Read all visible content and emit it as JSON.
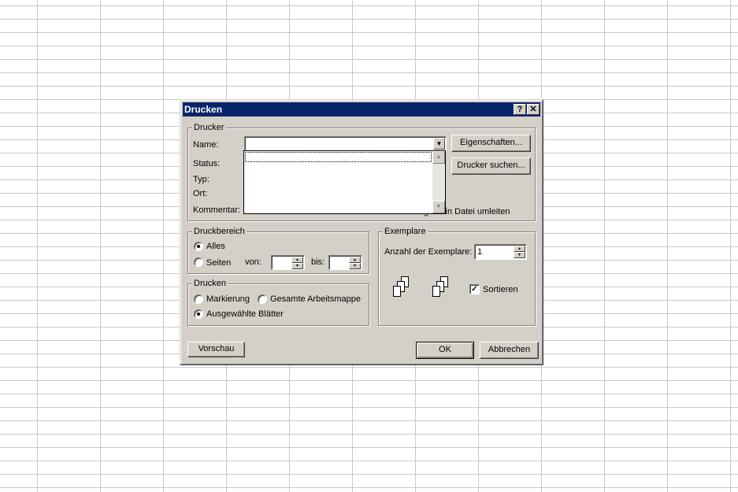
{
  "dialog": {
    "title": "Drucken",
    "help_button": "?",
    "close_button": "✕"
  },
  "printer": {
    "group_label": "Drucker",
    "name_label": "Name:",
    "status_label": "Status:",
    "type_label": "Typ:",
    "location_label": "Ort:",
    "comment_label": "Kommentar:",
    "name_value": "",
    "properties_button": "Eigenschaften...",
    "find_printer_button": "Drucker suchen...",
    "print_to_file_label": "gabe in Datei umleiten"
  },
  "print_range": {
    "group_label": "Druckbereich",
    "all_label": "Alles",
    "pages_label": "Seiten",
    "from_label": "von:",
    "to_label": "bis:",
    "from_value": "",
    "to_value": ""
  },
  "print_what": {
    "group_label": "Drucken",
    "selection_label": "Markierung",
    "entire_workbook_label": "Gesamte Arbeitsmappe",
    "selected_sheets_label": "Ausgewählte Blätter"
  },
  "copies": {
    "group_label": "Exemplare",
    "count_label": "Anzahl der Exemplare:",
    "count_value": "1",
    "collate_label": "Sortieren",
    "collate_checked": true
  },
  "footer": {
    "preview_button": "Vorschau",
    "ok_button": "OK",
    "cancel_button": "Abbrechen"
  }
}
